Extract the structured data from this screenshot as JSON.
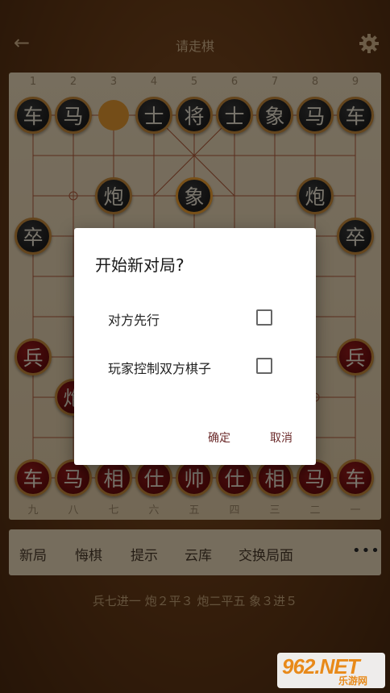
{
  "header": {
    "title": "请走棋",
    "back_icon": "arrow-left-icon",
    "settings_icon": "gear-icon"
  },
  "board": {
    "top_numbers": [
      "1",
      "2",
      "3",
      "4",
      "5",
      "6",
      "7",
      "8",
      "9"
    ],
    "bottom_numbers": [
      "九",
      "八",
      "七",
      "六",
      "五",
      "四",
      "三",
      "二",
      "一"
    ],
    "black_back_row": [
      "车",
      "马",
      "",
      "士",
      "将",
      "士",
      "象",
      "马",
      "车"
    ],
    "black_cannons": [
      "炮",
      "炮"
    ],
    "center_piece": "象",
    "black_soldiers": [
      "卒",
      "卒"
    ],
    "red_soldiers": [
      "兵",
      "兵"
    ],
    "red_cannon": "炮",
    "red_back_row": [
      "车",
      "马",
      "相",
      "仕",
      "帅",
      "仕",
      "相",
      "马",
      "车"
    ]
  },
  "toolbar": {
    "buttons": [
      "新局",
      "悔棋",
      "提示",
      "云库",
      "交换局面"
    ],
    "more_label": "•••"
  },
  "moves_text": "兵七进一 炮２平３ 炮二平五 象３进５",
  "dialog": {
    "title": "开始新对局?",
    "options": [
      {
        "label": "对方先行",
        "checked": false
      },
      {
        "label": "玩家控制双方棋子",
        "checked": false
      }
    ],
    "confirm": "确定",
    "cancel": "取消"
  },
  "watermark": {
    "main": "962.NET",
    "sub": "乐游网"
  },
  "colors": {
    "background": "#6a3c17",
    "board": "#eedcbc",
    "red_piece": "#8a1414",
    "black_piece": "#262626",
    "accent": "#e89a30"
  }
}
